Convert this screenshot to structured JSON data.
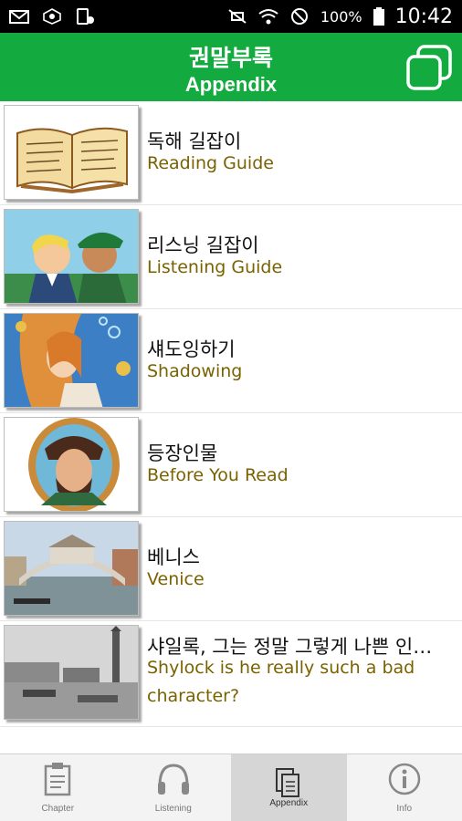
{
  "status_bar": {
    "battery_percent": "100%",
    "time": "10:42",
    "icons": [
      "mail-icon",
      "network-icon",
      "device-icon",
      "mute-icon",
      "wifi-icon",
      "do-not-disturb-icon",
      "battery-icon"
    ]
  },
  "header": {
    "title": "권말부록",
    "subtitle": "Appendix",
    "action_icon": "copy-icon",
    "color": "#13ab3f"
  },
  "items": [
    {
      "title": "독해 길잡이",
      "subtitle": "Reading Guide",
      "thumb": "open-book"
    },
    {
      "title": "리스닝 길잡이",
      "subtitle": "Listening Guide",
      "thumb": "two-men"
    },
    {
      "title": "섀도잉하기",
      "subtitle": "Shadowing",
      "thumb": "mermaid"
    },
    {
      "title": "등장인물",
      "subtitle": "Before You Read",
      "thumb": "portrait"
    },
    {
      "title": "베니스",
      "subtitle": "Venice",
      "thumb": "rialto-bridge"
    },
    {
      "title": "샤일록, 그는 정말 그렇게 나쁜 인…",
      "subtitle": "Shylock is he really such a bad character?",
      "thumb": "venice-harbor"
    }
  ],
  "tabs": [
    {
      "label": "Chapter",
      "icon": "clipboard-icon",
      "active": false
    },
    {
      "label": "Listening",
      "icon": "headphones-icon",
      "active": false
    },
    {
      "label": "Appendix",
      "icon": "appendix-icon",
      "active": true
    },
    {
      "label": "Info",
      "icon": "info-icon",
      "active": false
    }
  ],
  "colors": {
    "accent": "#13ab3f",
    "subtitle": "#7a6200"
  }
}
